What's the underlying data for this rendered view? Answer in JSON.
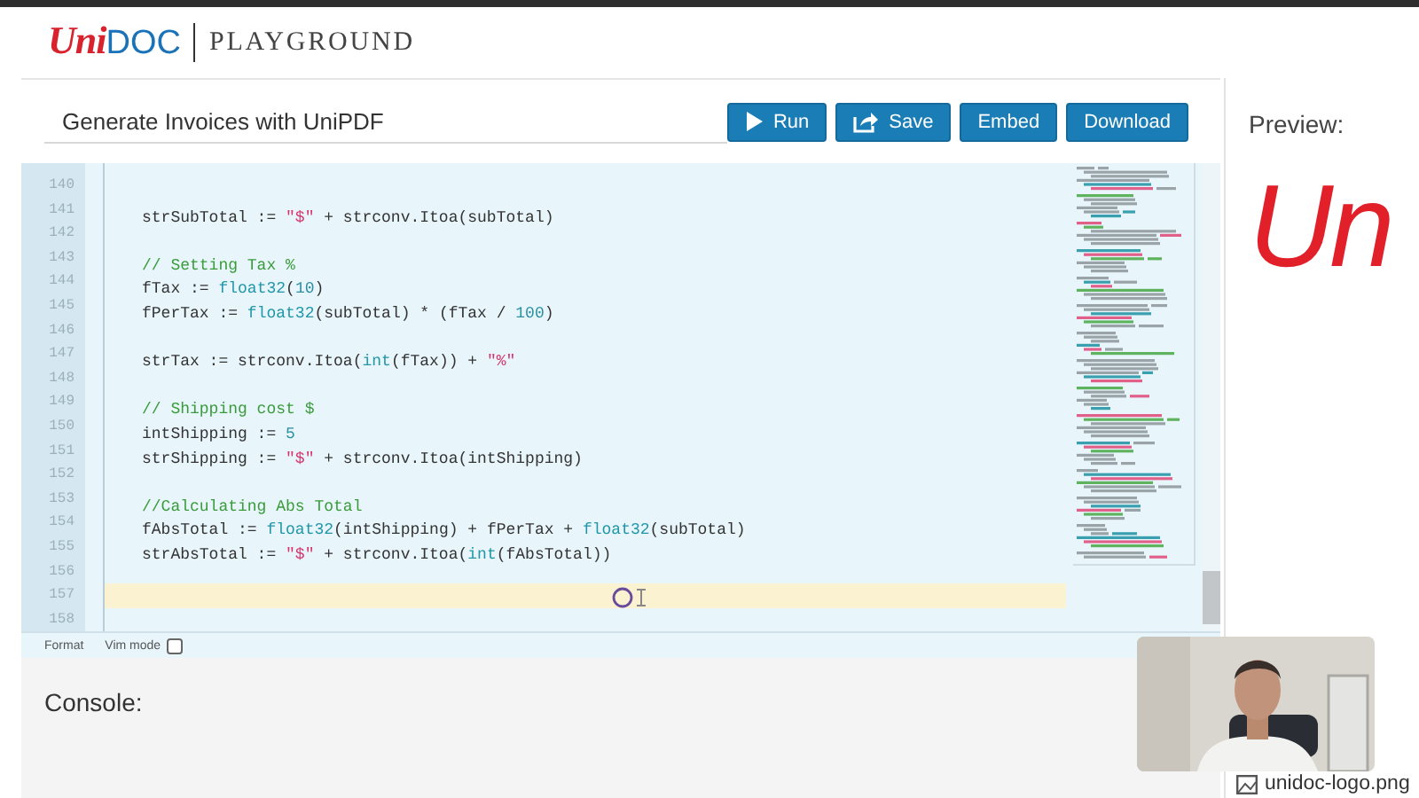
{
  "header": {
    "logo_prefix": "Uni",
    "logo_suffix": "DOC",
    "product": "PLAYGROUND"
  },
  "editor": {
    "title": "Generate Invoices with UniPDF",
    "buttons": [
      {
        "label": "Run",
        "kind": "play"
      },
      {
        "label": "Save",
        "kind": "share"
      },
      {
        "label": "Embed",
        "kind": "text"
      },
      {
        "label": "Download",
        "kind": "text"
      }
    ],
    "lines": [
      {
        "number": "140",
        "current": false
      },
      {
        "number": "141",
        "current": false,
        "tokens": [
          {
            "kind": "plain",
            "text": "strSubTotal := "
          },
          {
            "kind": "string",
            "text": "\"$\""
          },
          {
            "kind": "plain",
            "text": " + strconv.Itoa(subTotal)"
          }
        ]
      },
      {
        "number": "142",
        "current": false
      },
      {
        "number": "143",
        "current": false,
        "tokens": [
          {
            "kind": "comment",
            "text": "// Setting Tax %"
          }
        ]
      },
      {
        "number": "144",
        "current": false,
        "tokens": [
          {
            "kind": "plain",
            "text": "fTax := "
          },
          {
            "kind": "type",
            "text": "float32"
          },
          {
            "kind": "plain",
            "text": "("
          },
          {
            "kind": "number",
            "text": "10"
          },
          {
            "kind": "plain",
            "text": ")"
          }
        ]
      },
      {
        "number": "145",
        "current": false,
        "tokens": [
          {
            "kind": "plain",
            "text": "fPerTax := "
          },
          {
            "kind": "type",
            "text": "float32"
          },
          {
            "kind": "plain",
            "text": "(subTotal) * (fTax / "
          },
          {
            "kind": "number",
            "text": "100"
          },
          {
            "kind": "plain",
            "text": ")"
          }
        ]
      },
      {
        "number": "146",
        "current": false
      },
      {
        "number": "147",
        "current": false,
        "tokens": [
          {
            "kind": "plain",
            "text": "strTax := strconv.Itoa("
          },
          {
            "kind": "type",
            "text": "int"
          },
          {
            "kind": "plain",
            "text": "(fTax)) + "
          },
          {
            "kind": "string",
            "text": "\"%\""
          }
        ]
      },
      {
        "number": "148",
        "current": false
      },
      {
        "number": "149",
        "current": false,
        "tokens": [
          {
            "kind": "comment",
            "text": "// Shipping cost $"
          }
        ]
      },
      {
        "number": "150",
        "current": false,
        "tokens": [
          {
            "kind": "plain",
            "text": "intShipping := "
          },
          {
            "kind": "number",
            "text": "5"
          }
        ]
      },
      {
        "number": "151",
        "current": false,
        "tokens": [
          {
            "kind": "plain",
            "text": "strShipping := "
          },
          {
            "kind": "string",
            "text": "\"$\""
          },
          {
            "kind": "plain",
            "text": " + strconv.Itoa(intShipping)"
          }
        ]
      },
      {
        "number": "152",
        "current": false
      },
      {
        "number": "153",
        "current": false,
        "tokens": [
          {
            "kind": "comment",
            "text": "//Calculating Abs Total"
          }
        ]
      },
      {
        "number": "154",
        "current": false,
        "tokens": [
          {
            "kind": "plain",
            "text": "fAbsTotal := "
          },
          {
            "kind": "type",
            "text": "float32"
          },
          {
            "kind": "plain",
            "text": "(intShipping) + fPerTax + "
          },
          {
            "kind": "type",
            "text": "float32"
          },
          {
            "kind": "plain",
            "text": "(subTotal)"
          }
        ]
      },
      {
        "number": "155",
        "current": false,
        "tokens": [
          {
            "kind": "plain",
            "text": "strAbsTotal := "
          },
          {
            "kind": "string",
            "text": "\"$\""
          },
          {
            "kind": "plain",
            "text": " + strconv.Itoa("
          },
          {
            "kind": "type",
            "text": "int"
          },
          {
            "kind": "plain",
            "text": "(fAbsTotal))"
          }
        ]
      },
      {
        "number": "156",
        "current": false
      },
      {
        "number": "157",
        "current": true
      },
      {
        "number": "158",
        "current": false
      }
    ],
    "footer": {
      "format_label": "Format",
      "vim_label": "Vim mode",
      "vim_checked": false
    }
  },
  "console": {
    "title": "Console:"
  },
  "preview": {
    "title": "Preview:",
    "logo_text": "Un",
    "file_name": "unidoc-logo.png"
  }
}
